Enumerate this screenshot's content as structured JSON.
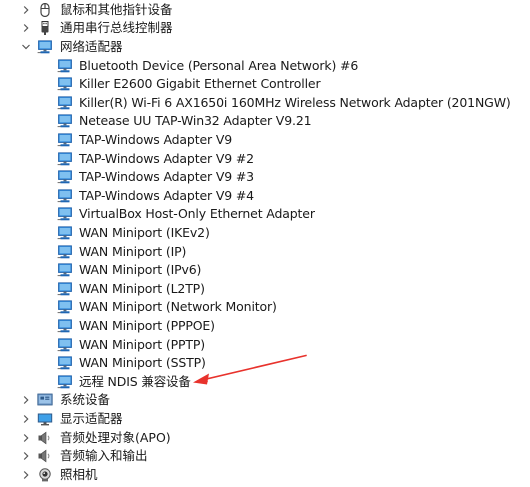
{
  "categories_top": [
    {
      "label": "鼠标和其他指针设备",
      "icon": "mouse-icon",
      "expanded": false
    },
    {
      "label": "通用串行总线控制器",
      "icon": "usb-plug-icon",
      "expanded": false
    },
    {
      "label": "网络适配器",
      "icon": "network-adapter-icon",
      "expanded": true
    }
  ],
  "network_adapters": [
    "Bluetooth Device (Personal Area Network) #6",
    "Killer E2600 Gigabit Ethernet Controller",
    "Killer(R) Wi-Fi 6 AX1650i 160MHz Wireless Network Adapter (201NGW)",
    "Netease UU TAP-Win32 Adapter V9.21",
    "TAP-Windows Adapter V9",
    "TAP-Windows Adapter V9 #2",
    "TAP-Windows Adapter V9 #3",
    "TAP-Windows Adapter V9 #4",
    "VirtualBox Host-Only Ethernet Adapter",
    "WAN Miniport (IKEv2)",
    "WAN Miniport (IP)",
    "WAN Miniport (IPv6)",
    "WAN Miniport (L2TP)",
    "WAN Miniport (Network Monitor)",
    "WAN Miniport (PPPOE)",
    "WAN Miniport (PPTP)",
    "WAN Miniport (SSTP)",
    "远程 NDIS 兼容设备"
  ],
  "categories_bottom": [
    {
      "label": "系统设备",
      "icon": "system-devices-icon",
      "expanded": false
    },
    {
      "label": "显示适配器",
      "icon": "display-adapter-icon",
      "expanded": false
    },
    {
      "label": "音频处理对象(APO)",
      "icon": "speaker-icon",
      "expanded": false
    },
    {
      "label": "音频输入和输出",
      "icon": "speaker-icon",
      "expanded": false
    },
    {
      "label": "照相机",
      "icon": "camera-icon",
      "expanded": false
    }
  ],
  "annotation": {
    "color": "#e8322c",
    "points_to": "远程 NDIS 兼容设备"
  },
  "colors": {
    "adapter_icon": "#2b84d8",
    "adapter_base": "#1e66b3",
    "chevron": "#555555"
  }
}
